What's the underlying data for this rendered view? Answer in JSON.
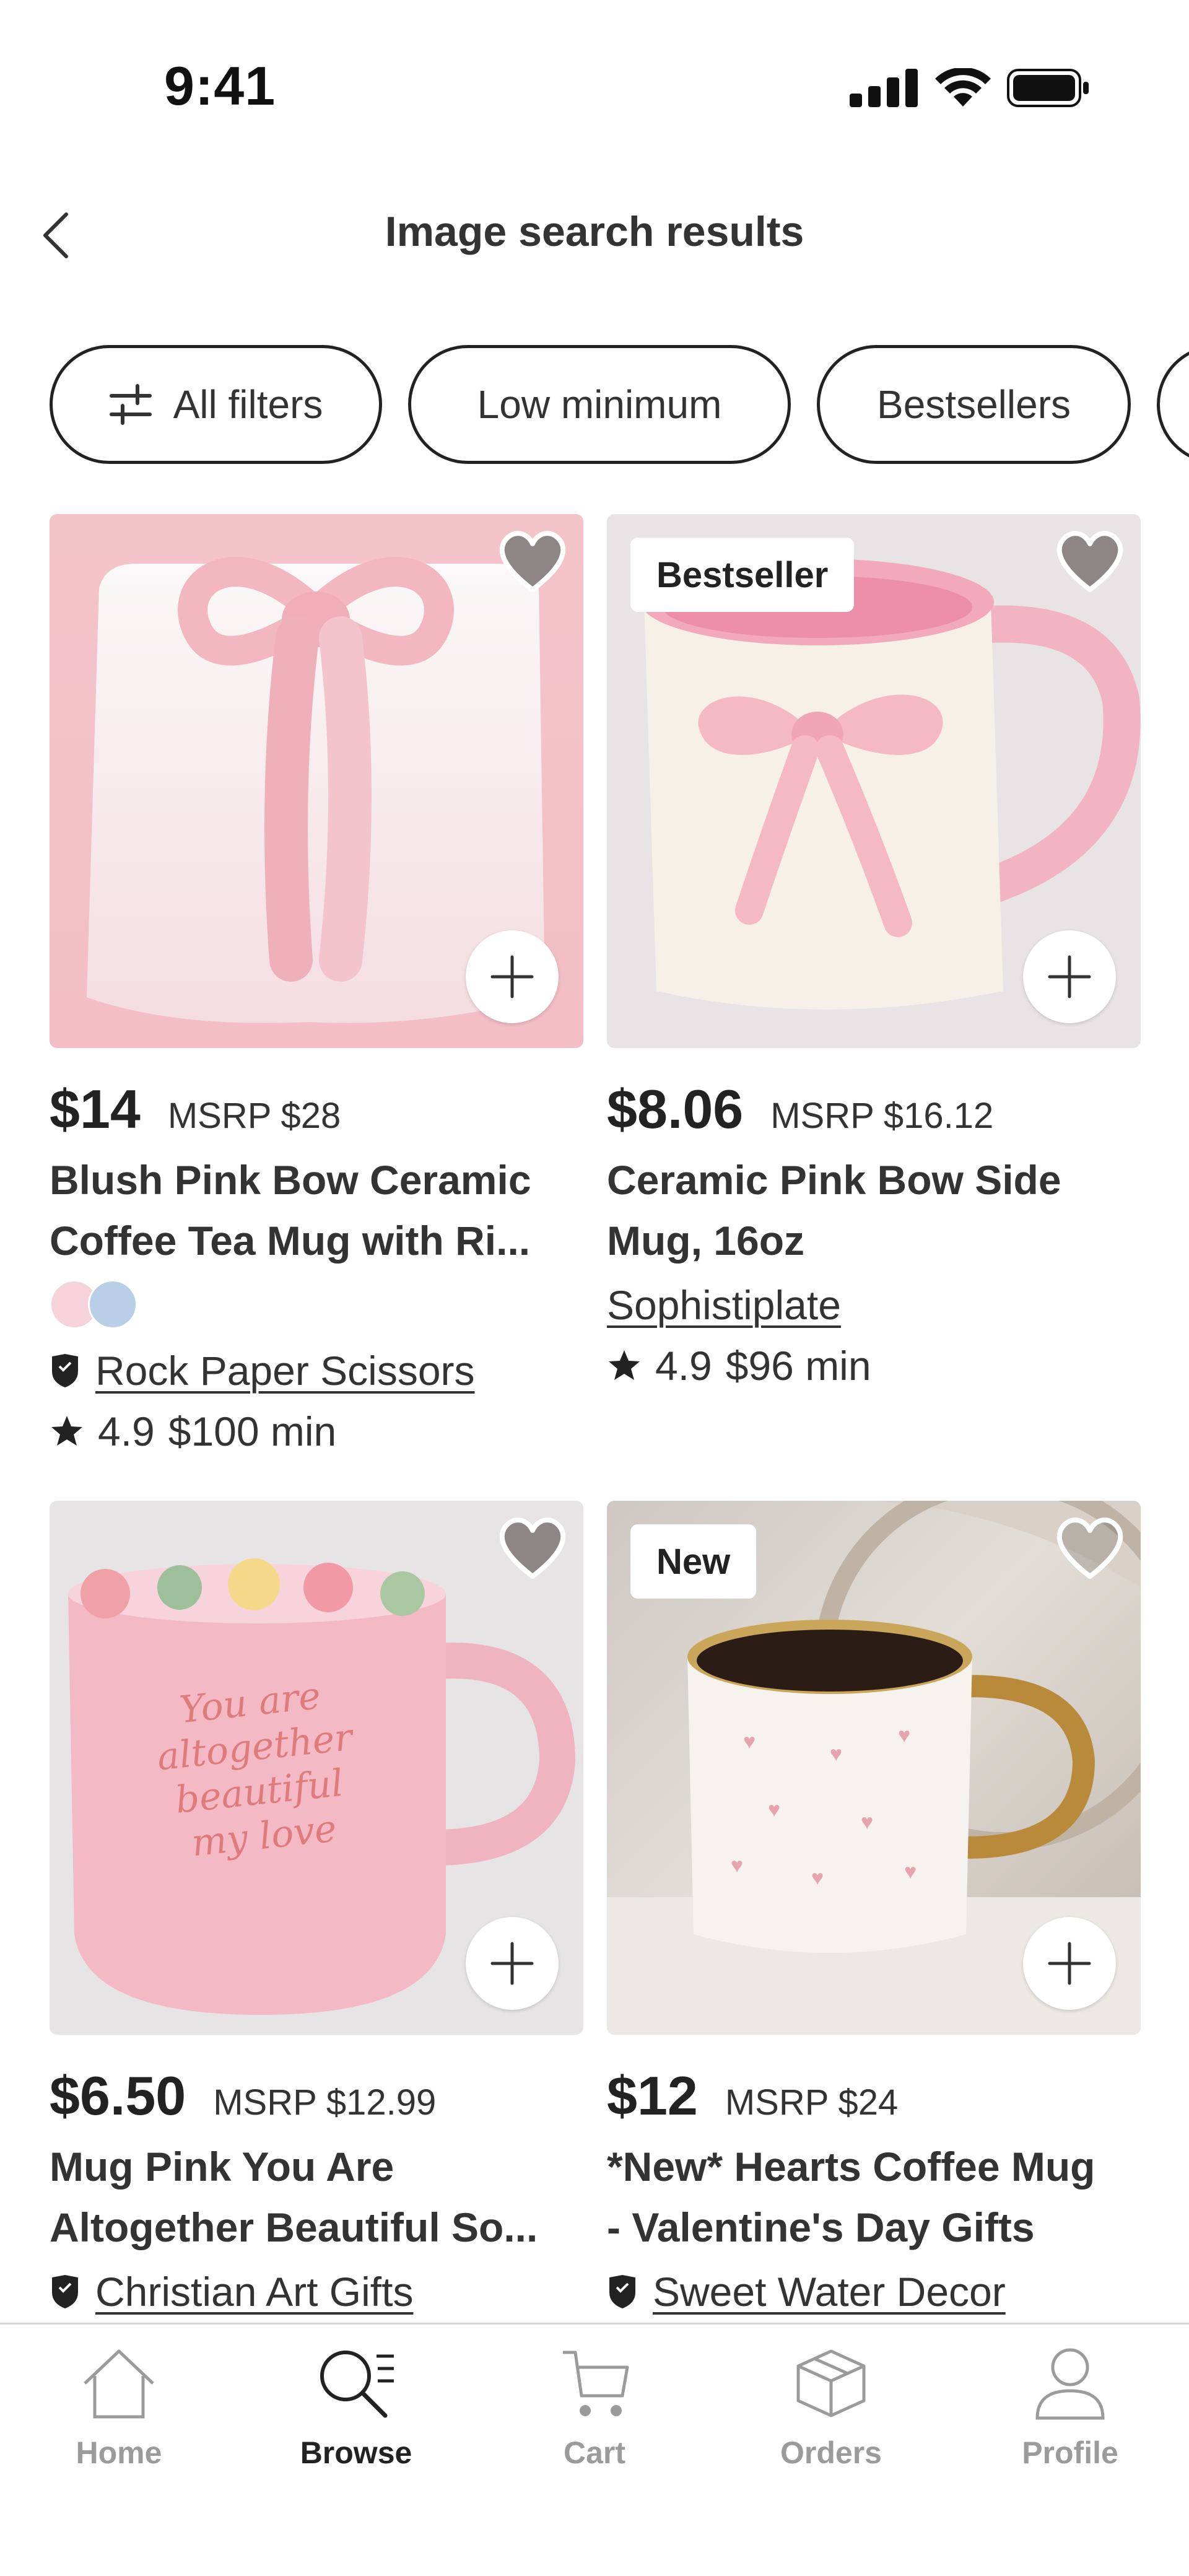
{
  "status_bar": {
    "time": "9:41"
  },
  "header": {
    "title": "Image search results"
  },
  "filters": [
    {
      "label": "All filters"
    },
    {
      "label": "Low minimum"
    },
    {
      "label": "Bestsellers"
    }
  ],
  "products": [
    {
      "price": "$14",
      "msrp": "MSRP $28",
      "title_line1": "Blush Pink Bow Ceramic",
      "title_line2": "Coffee Tea Mug with Ri...",
      "seller": "Rock Paper Scissors",
      "rating": "4.9",
      "min": "$100 min",
      "badge": "",
      "swatch_colors": [
        "#f6d3da",
        "#b9cfe7"
      ]
    },
    {
      "price": "$8.06",
      "msrp": "MSRP $16.12",
      "title_line1": "Ceramic Pink Bow Side",
      "title_line2": "Mug, 16oz",
      "seller": "Sophistiplate",
      "rating": "4.9",
      "min": "$96 min",
      "badge": "Bestseller"
    },
    {
      "price": "$6.50",
      "msrp": "MSRP $12.99",
      "title_line1": "Mug Pink You Are",
      "title_line2": "Altogether Beautiful So...",
      "seller": "Christian Art Gifts",
      "badge": "",
      "mug_text": "You are altogether beautiful my love"
    },
    {
      "price": "$12",
      "msrp": "MSRP $24",
      "title_line1": "*New* Hearts Coffee Mug",
      "title_line2": "- Valentine's Day Gifts",
      "seller": "Sweet Water Decor",
      "badge": "New"
    }
  ],
  "tabbar": [
    {
      "label": "Home",
      "icon": "home-icon",
      "active": false
    },
    {
      "label": "Browse",
      "icon": "browse-icon",
      "active": true
    },
    {
      "label": "Cart",
      "icon": "cart-icon",
      "active": false
    },
    {
      "label": "Orders",
      "icon": "orders-icon",
      "active": false
    },
    {
      "label": "Profile",
      "icon": "profile-icon",
      "active": false
    }
  ],
  "colors": {
    "text": "#222222",
    "inactive_tab": "#9b9b9b",
    "border": "#222222"
  }
}
